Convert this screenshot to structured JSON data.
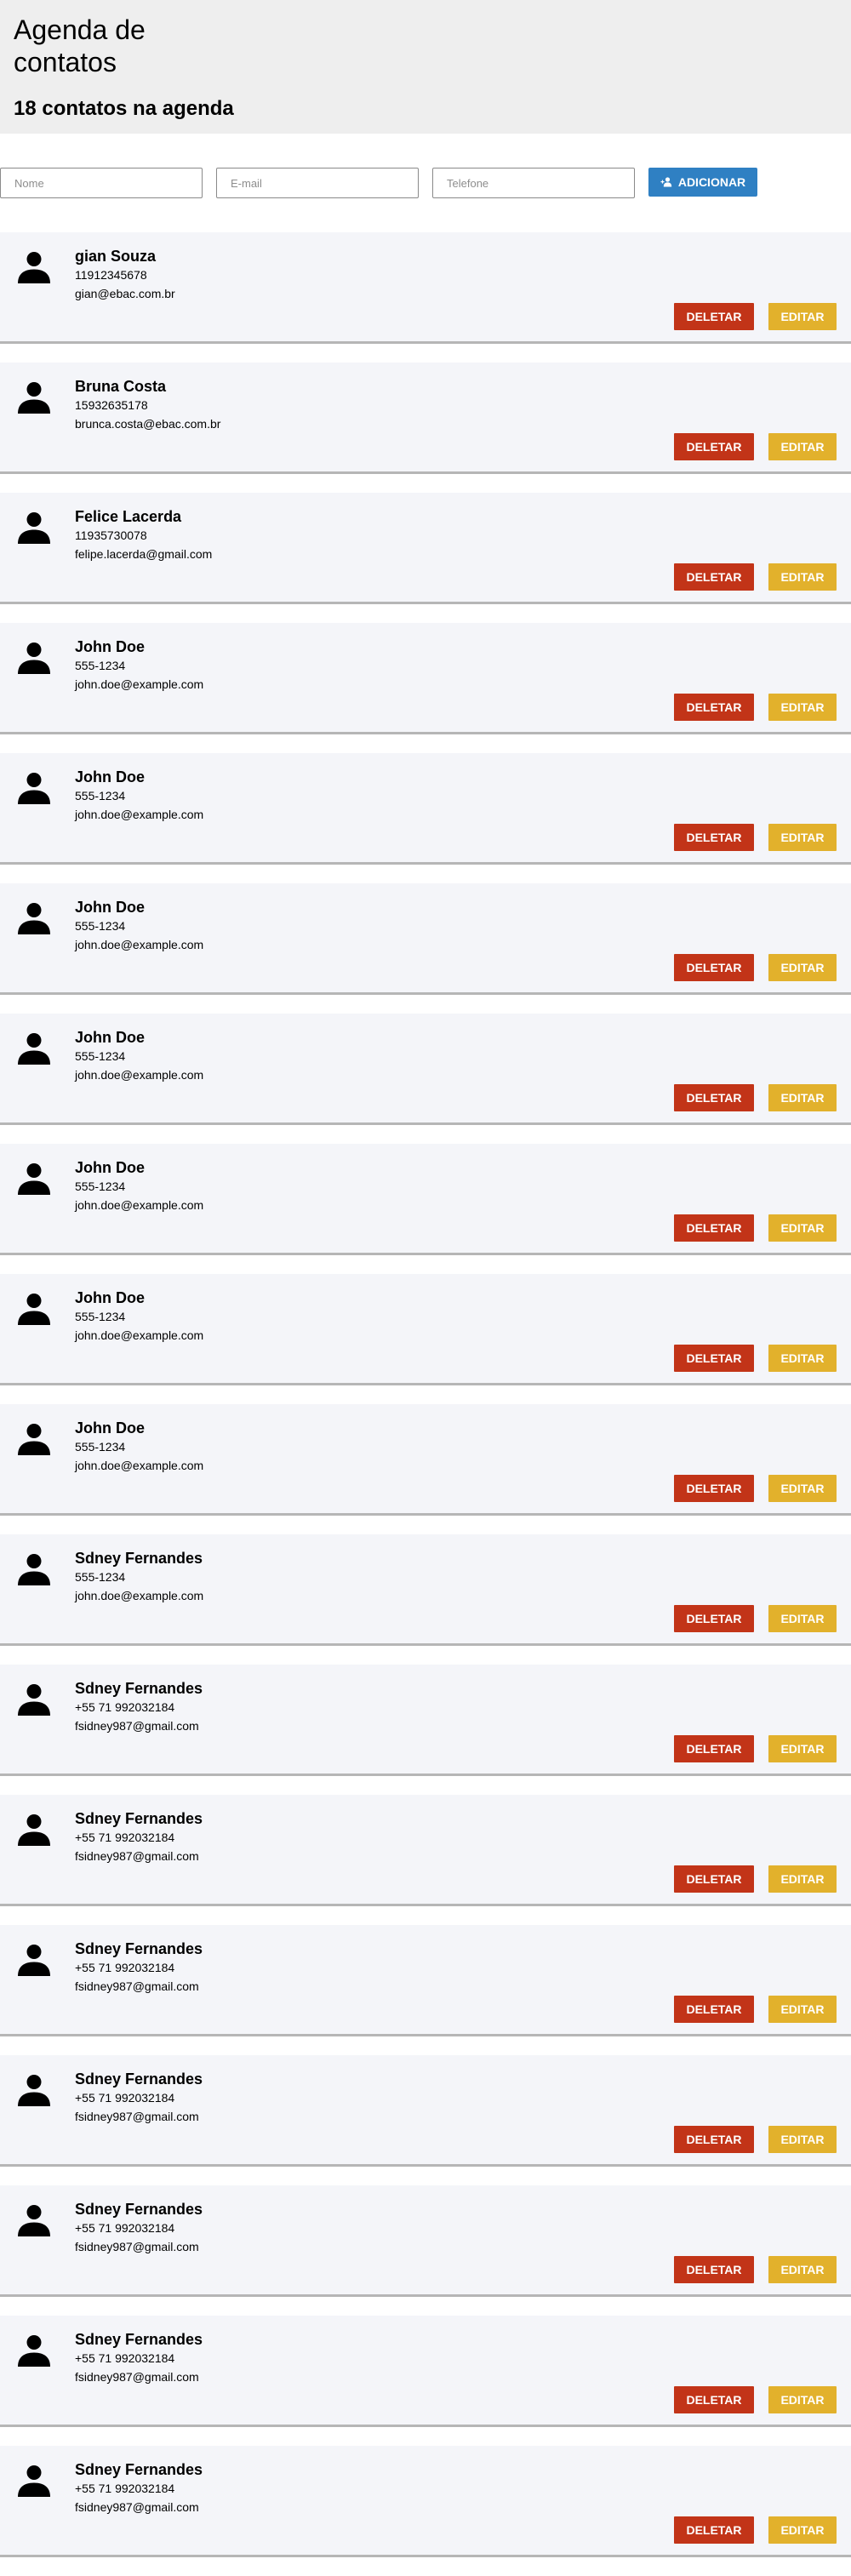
{
  "header": {
    "title": "Agenda de contatos",
    "count_text": "18 contatos na agenda"
  },
  "form": {
    "name_placeholder": "Nome",
    "email_placeholder": "E-mail",
    "phone_placeholder": "Telefone",
    "add_label": "ADICIONAR",
    "add_icon": "add-user-icon"
  },
  "colors": {
    "header_bg": "#eeeeee",
    "card_bg": "#f4f5f9",
    "add_button": "#2f80c3",
    "delete_button": "#c23418",
    "edit_button": "#e2b12c"
  },
  "contact_actions": {
    "delete_label": "DELETAR",
    "edit_label": "EDITAR",
    "avatar_icon": "user-icon"
  },
  "contacts": [
    {
      "name": "gian Souza",
      "phone": "11912345678",
      "email": "gian@ebac.com.br"
    },
    {
      "name": "Bruna Costa",
      "phone": "15932635178",
      "email": "brunca.costa@ebac.com.br"
    },
    {
      "name": "Felice Lacerda",
      "phone": "11935730078",
      "email": "felipe.lacerda@gmail.com"
    },
    {
      "name": "John Doe",
      "phone": "555-1234",
      "email": "john.doe@example.com"
    },
    {
      "name": "John Doe",
      "phone": "555-1234",
      "email": "john.doe@example.com"
    },
    {
      "name": "John Doe",
      "phone": "555-1234",
      "email": "john.doe@example.com"
    },
    {
      "name": "John Doe",
      "phone": "555-1234",
      "email": "john.doe@example.com"
    },
    {
      "name": "John Doe",
      "phone": "555-1234",
      "email": "john.doe@example.com"
    },
    {
      "name": "John Doe",
      "phone": "555-1234",
      "email": "john.doe@example.com"
    },
    {
      "name": "John Doe",
      "phone": "555-1234",
      "email": "john.doe@example.com"
    },
    {
      "name": "Sdney Fernandes",
      "phone": "555-1234",
      "email": "john.doe@example.com"
    },
    {
      "name": "Sdney Fernandes",
      "phone": "+55 71 992032184",
      "email": "fsidney987@gmail.com"
    },
    {
      "name": "Sdney Fernandes",
      "phone": "+55 71 992032184",
      "email": "fsidney987@gmail.com"
    },
    {
      "name": "Sdney Fernandes",
      "phone": "+55 71 992032184",
      "email": "fsidney987@gmail.com"
    },
    {
      "name": "Sdney Fernandes",
      "phone": "+55 71 992032184",
      "email": "fsidney987@gmail.com"
    },
    {
      "name": "Sdney Fernandes",
      "phone": "+55 71 992032184",
      "email": "fsidney987@gmail.com"
    },
    {
      "name": "Sdney Fernandes",
      "phone": "+55 71 992032184",
      "email": "fsidney987@gmail.com"
    },
    {
      "name": "Sdney Fernandes",
      "phone": "+55 71 992032184",
      "email": "fsidney987@gmail.com"
    }
  ]
}
